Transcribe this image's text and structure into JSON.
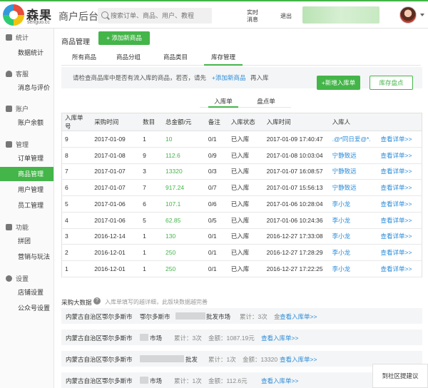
{
  "brand": {
    "name": "森果",
    "sub": "senguo.cc"
  },
  "header": {
    "title": "商户后台",
    "search_placeholder": "搜索订单、商品、用户、教程",
    "realtime_msg": [
      "实时",
      "消息"
    ],
    "exit": "退出"
  },
  "sidebar": {
    "groups": [
      {
        "head": "统计",
        "items": [
          "数据统计"
        ]
      },
      {
        "head": "客服",
        "items": [
          "消息与评价"
        ]
      },
      {
        "head": "账户",
        "items": [
          "账户余额"
        ]
      },
      {
        "head": "管理",
        "items": [
          "订单管理",
          "商品管理",
          "用户管理",
          "员工管理"
        ]
      },
      {
        "head": "功能",
        "items": [
          "拼团",
          "营销与玩法"
        ]
      },
      {
        "head": "设置",
        "items": [
          "店铺设置",
          "公众号设置"
        ]
      }
    ],
    "active_item": "商品管理"
  },
  "page": {
    "title": "商品管理",
    "add_button": "+ 添加新商品",
    "tabs": [
      "所有商品",
      "商品分组",
      "商品类目",
      "库存管理"
    ],
    "active_tab": "库存管理",
    "notice": {
      "text1": "请检查商品库中是否有流入库的商品，若否，请先",
      "link": "+添加新商品",
      "text2": "再入库"
    },
    "new_inbound_button": "+新增入库单",
    "stock_check_button": "库存盘点",
    "subtabs": [
      "入库单",
      "盘点单"
    ],
    "active_subtab": "入库单"
  },
  "table": {
    "headers": [
      "入库单号",
      "采购时间",
      "数目",
      "总金额/元",
      "备注",
      "入库状态",
      "入库时间",
      "入库人",
      ""
    ],
    "rows": [
      [
        "9",
        "2017-01-09",
        "1",
        "10",
        "0/1",
        "已入库",
        "2017-01-09 17:40:47",
        ".@*同日爱@*.",
        "查看详单>>"
      ],
      [
        "8",
        "2017-01-08",
        "9",
        "112.6",
        "0/9",
        "已入库",
        "2017-01-08 10:03:04",
        "宁静致远",
        "查看详单>>"
      ],
      [
        "7",
        "2017-01-07",
        "3",
        "13320",
        "0/3",
        "已入库",
        "2017-01-07 16:08:57",
        "宁静致远",
        "查看详单>>"
      ],
      [
        "6",
        "2017-01-07",
        "7",
        "917.24",
        "0/7",
        "已入库",
        "2017-01-07 15:56:13",
        "宁静致远",
        "查看详单>>"
      ],
      [
        "5",
        "2017-01-06",
        "6",
        "107.1",
        "0/6",
        "已入库",
        "2017-01-06 10:28:04",
        "李小龙",
        "查看详单>>"
      ],
      [
        "4",
        "2017-01-06",
        "5",
        "62.85",
        "0/5",
        "已入库",
        "2017-01-06 10:24:36",
        "李小龙",
        "查看详单>>"
      ],
      [
        "3",
        "2016-12-14",
        "1",
        "130",
        "0/1",
        "已入库",
        "2016-12-27 17:33:08",
        "李小龙",
        "查看详单>>"
      ],
      [
        "2",
        "2016-12-01",
        "1",
        "250",
        "0/1",
        "已入库",
        "2016-12-27 17:28:29",
        "李小龙",
        "查看详单>>"
      ],
      [
        "1",
        "2016-12-01",
        "1",
        "250",
        "0/1",
        "已入库",
        "2016-12-27 17:22:25",
        "李小龙",
        "查看详单>>"
      ]
    ]
  },
  "procurement": {
    "title": "采购大数据",
    "hint": "入库单填写的越详细，此版块数据越完善",
    "rows": [
      {
        "region": "内蒙古自治区鄂尔多斯市",
        "city": "鄂尔多斯市",
        "market": "批发市场",
        "stats": "累计：3次",
        "amount": "金",
        "link": "查看入库单>>"
      },
      {
        "region": "内蒙古自治区鄂尔多斯市",
        "city": "",
        "market": "市场",
        "stats": "累计：3次",
        "amount": "金额：1087.19元",
        "link": "查看入库单>>"
      },
      {
        "region": "内蒙古自治区鄂尔多斯市",
        "city": "",
        "market": "批发",
        "stats": "累计：1次",
        "amount": "金额：13320",
        "link": "查看入库单>>"
      },
      {
        "region": "内蒙古自治区鄂尔多斯市",
        "city": "",
        "market": "市场",
        "stats": "累计：1次",
        "amount": "金额：112.6元",
        "link": "查看入库单>>"
      }
    ]
  },
  "feedback": "到社区提建议"
}
